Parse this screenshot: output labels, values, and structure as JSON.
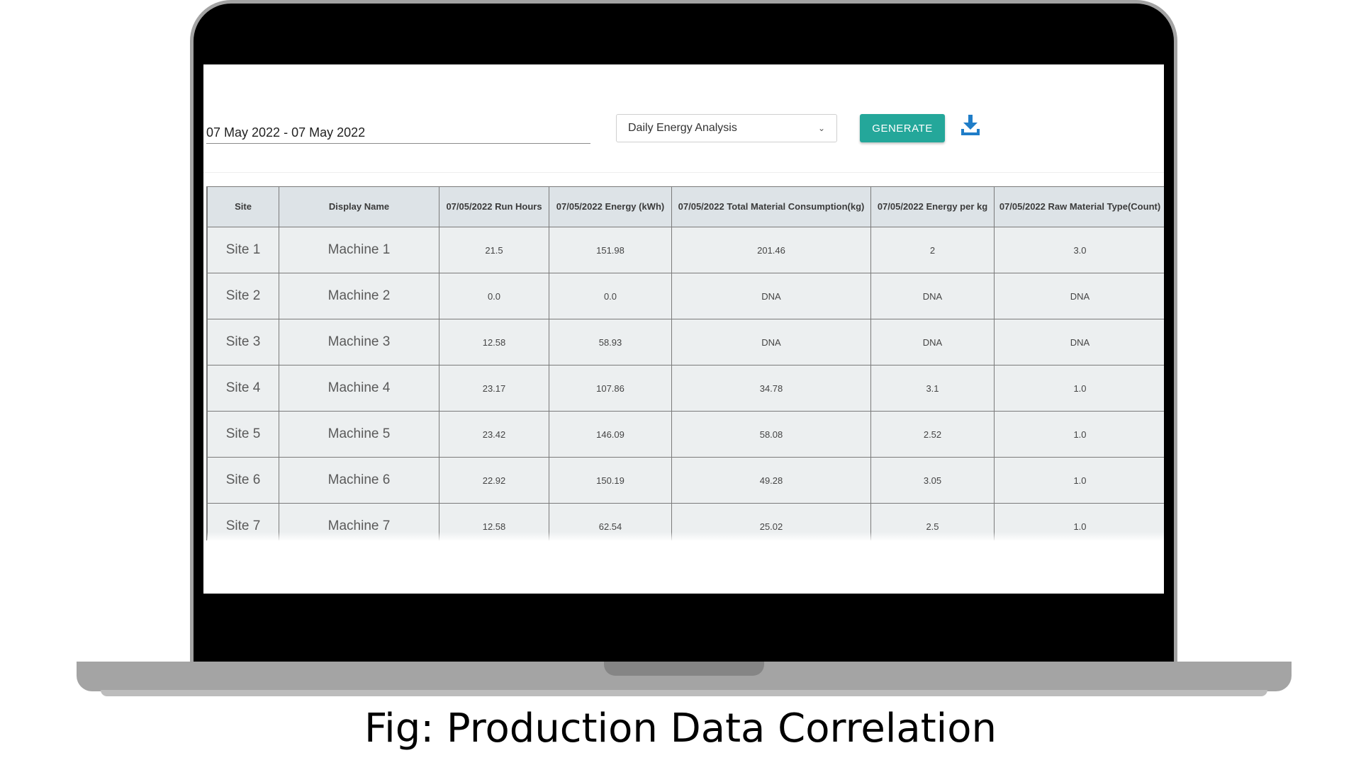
{
  "toolbar": {
    "date_range": "07 May 2022 - 07 May 2022",
    "report_type": "Daily Energy Analysis",
    "generate_label": "GENERATE",
    "download_icon": "download-icon",
    "accent_color": "#24a79a",
    "download_color": "#1f7dc8"
  },
  "table": {
    "headers": [
      "Site",
      "Display Name",
      "07/05/2022 Run Hours",
      "07/05/2022 Energy (kWh)",
      "07/05/2022 Total Material Consumption(kg)",
      "07/05/2022 Energy per kg",
      "07/05/2022 Raw Material Type(Count)"
    ],
    "rows": [
      [
        "Site 1",
        "Machine 1",
        "21.5",
        "151.98",
        "201.46",
        "2",
        "3.0"
      ],
      [
        "Site 2",
        "Machine 2",
        "0.0",
        "0.0",
        "DNA",
        "DNA",
        "DNA"
      ],
      [
        "Site 3",
        "Machine 3",
        "12.58",
        "58.93",
        "DNA",
        "DNA",
        "DNA"
      ],
      [
        "Site 4",
        "Machine 4",
        "23.17",
        "107.86",
        "34.78",
        "3.1",
        "1.0"
      ],
      [
        "Site 5",
        "Machine 5",
        "23.42",
        "146.09",
        "58.08",
        "2.52",
        "1.0"
      ],
      [
        "Site 6",
        "Machine 6",
        "22.92",
        "150.19",
        "49.28",
        "3.05",
        "1.0"
      ],
      [
        "Site 7",
        "Machine 7",
        "12.58",
        "62.54",
        "25.02",
        "2.5",
        "1.0"
      ]
    ]
  },
  "caption": "Fig: Production Data Correlation"
}
